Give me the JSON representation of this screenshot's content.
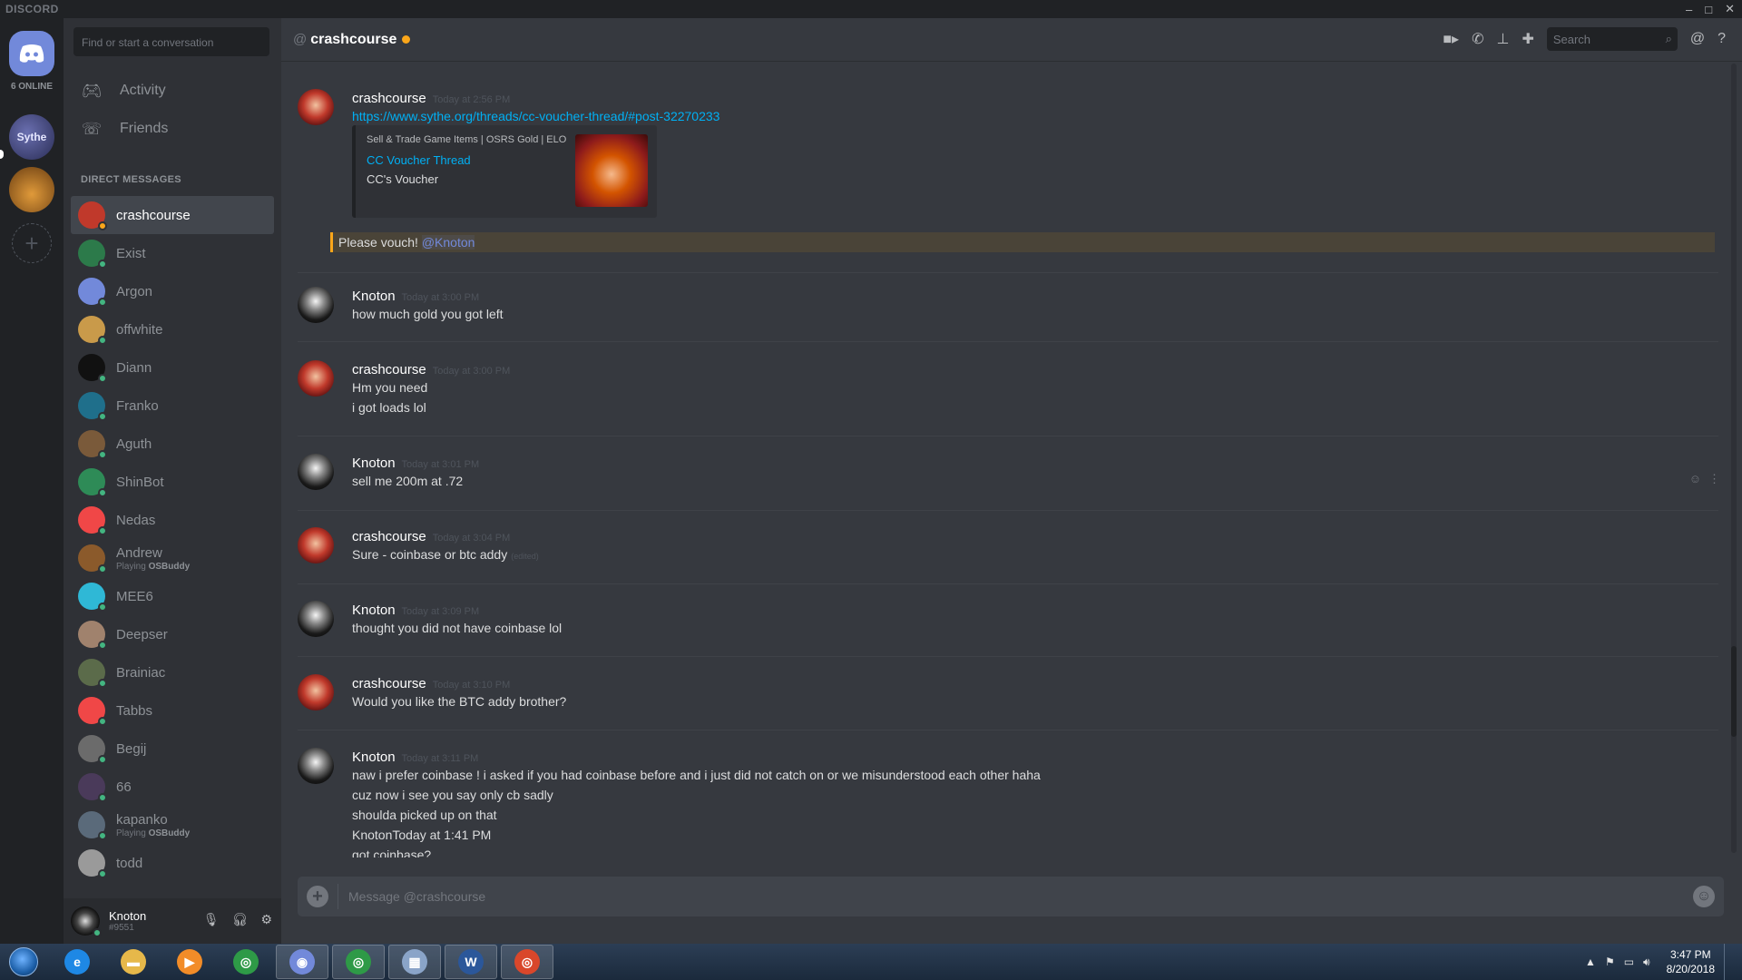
{
  "app": {
    "brand": "DISCORD"
  },
  "window_controls": {
    "minimize": "–",
    "maximize": "□",
    "close": "✕"
  },
  "servers": {
    "online_count": "6 ONLINE",
    "sythe_label": "Sythe",
    "add_label": "+"
  },
  "sidebar": {
    "search_placeholder": "Find or start a conversation",
    "nav": [
      {
        "label": "Activity",
        "icon": "gamepad-icon"
      },
      {
        "label": "Friends",
        "icon": "friends-icon"
      }
    ],
    "dm_header": "DIRECT MESSAGES",
    "dms": [
      {
        "name": "crashcourse",
        "status": "idle",
        "color": "#c0392b",
        "active": true
      },
      {
        "name": "Exist",
        "status": "online",
        "color": "#2c7a4a"
      },
      {
        "name": "Argon",
        "status": "online",
        "color": "#7289da"
      },
      {
        "name": "offwhite",
        "status": "online",
        "color": "#c99a4a"
      },
      {
        "name": "Diann",
        "status": "online",
        "color": "#111111"
      },
      {
        "name": "Franko",
        "status": "online",
        "color": "#1f6f8b"
      },
      {
        "name": "Aguth",
        "status": "online",
        "color": "#7a5a3a"
      },
      {
        "name": "ShinBot",
        "status": "online",
        "color": "#2e8b57"
      },
      {
        "name": "Nedas",
        "status": "online",
        "color": "#f04747"
      },
      {
        "name": "Andrew",
        "status": "online",
        "color": "#8b5a2b",
        "activity_prefix": "Playing",
        "activity_game": "OSBuddy"
      },
      {
        "name": "MEE6",
        "status": "online",
        "color": "#2fb8d6"
      },
      {
        "name": "Deepser",
        "status": "online",
        "color": "#a0826d"
      },
      {
        "name": "Brainiac",
        "status": "online",
        "color": "#5b6b4a"
      },
      {
        "name": "Tabbs",
        "status": "online",
        "color": "#f04747"
      },
      {
        "name": "Begij",
        "status": "online",
        "color": "#6b6b6b"
      },
      {
        "name": "66",
        "status": "online",
        "color": "#4a3a5a"
      },
      {
        "name": "kapanko",
        "status": "online",
        "color": "#5a6a7a",
        "activity_prefix": "Playing",
        "activity_game": "OSBuddy"
      },
      {
        "name": "todd",
        "status": "online",
        "color": "#9a9a9a"
      }
    ]
  },
  "user_panel": {
    "username": "Knoton",
    "tag": "#9551"
  },
  "chat_header": {
    "at": "@",
    "channel": "crashcourse",
    "search_placeholder": "Search"
  },
  "messages": {
    "m1": {
      "author": "crashcourse",
      "time": "Today at 2:56 PM",
      "link": "https://www.sythe.org/threads/cc-voucher-thread/#post-32270233",
      "embed": {
        "provider": "Sell & Trade Game Items | OSRS Gold | ELO",
        "title": "CC Voucher Thread",
        "description": "CC's Voucher"
      },
      "mention_text": "Please vouch! ",
      "mention": "@Knoton"
    },
    "m2": {
      "author": "Knoton",
      "time": "Today at 3:00 PM",
      "l1": "how much gold you got left"
    },
    "m3": {
      "author": "crashcourse",
      "time": "Today at 3:00 PM",
      "l1": "Hm you need",
      "l2": "i got loads lol"
    },
    "m4": {
      "author": "Knoton",
      "time": "Today at 3:01 PM",
      "l1": "sell me 200m at .72"
    },
    "m5": {
      "author": "crashcourse",
      "time": "Today at 3:04 PM",
      "l1": "Sure - coinbase or btc addy",
      "edited": "(edited)"
    },
    "m6": {
      "author": "Knoton",
      "time": "Today at 3:09 PM",
      "l1": "thought you did not have coinbase lol"
    },
    "m7": {
      "author": "crashcourse",
      "time": "Today at 3:10 PM",
      "l1": "Would you like the BTC addy brother?"
    },
    "m8": {
      "author": "Knoton",
      "time": "Today at 3:11 PM",
      "l1": "naw i prefer coinbase ! i asked if you had coinbase before and i just did not catch on or we misunderstood each other haha",
      "l2": "cuz now i see you say only cb sadly",
      "l3": "shoulda picked up on that",
      "l4": "KnotonToday at 1:41 PM",
      "l5": "got coinbase?"
    }
  },
  "composer": {
    "placeholder": "Message @crashcourse"
  },
  "taskbar": {
    "apps": [
      {
        "name": "ie-icon",
        "label": "e",
        "color": "#1e88e5"
      },
      {
        "name": "folder-icon",
        "label": "▬",
        "color": "#e6b84a"
      },
      {
        "name": "media-player-icon",
        "label": "▶",
        "color": "#f28c28"
      },
      {
        "name": "chrome-icon",
        "label": "◎",
        "color": "#2e9a47"
      },
      {
        "name": "discord-app-icon",
        "label": "◉",
        "color": "#7289da"
      },
      {
        "name": "chrome-icon-2",
        "label": "◎",
        "color": "#2e9a47"
      },
      {
        "name": "calculator-icon",
        "label": "▦",
        "color": "#8aa4c8"
      },
      {
        "name": "word-icon",
        "label": "W",
        "color": "#2b579a"
      },
      {
        "name": "firefox-icon",
        "label": "◎",
        "color": "#d9472b"
      }
    ],
    "time": "3:47 PM",
    "date": "8/20/2018"
  }
}
